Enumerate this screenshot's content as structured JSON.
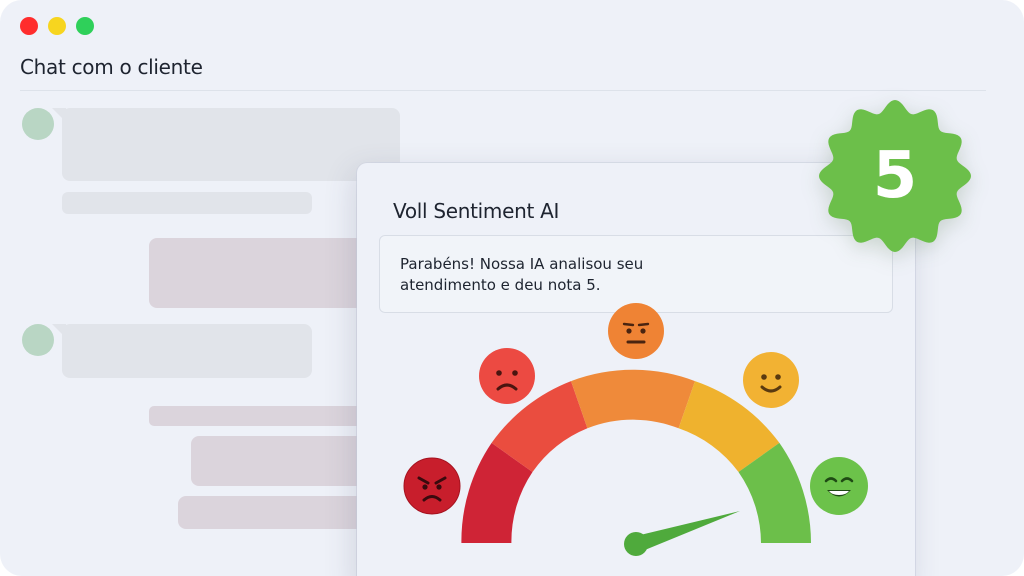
{
  "window": {
    "title": "Chat com o cliente",
    "controls": [
      "close",
      "minimize",
      "maximize"
    ]
  },
  "panel": {
    "title": "Voll Sentiment AI",
    "message": "Parabéns! Nossa IA analisou seu atendimento e deu nota 5."
  },
  "badge": {
    "score": "5",
    "color": "#6cbf4a"
  },
  "gauge": {
    "segments": [
      "very-negative",
      "negative",
      "neutral",
      "positive",
      "very-positive"
    ],
    "colors": [
      "#cf2436",
      "#ea4d3f",
      "#ef8a3a",
      "#efb22e",
      "#6cbf4a"
    ],
    "needle_level": "very-positive"
  },
  "emojis": [
    "angry-face-icon",
    "sad-face-icon",
    "neutral-face-icon",
    "smiling-face-icon",
    "grinning-face-icon"
  ]
}
